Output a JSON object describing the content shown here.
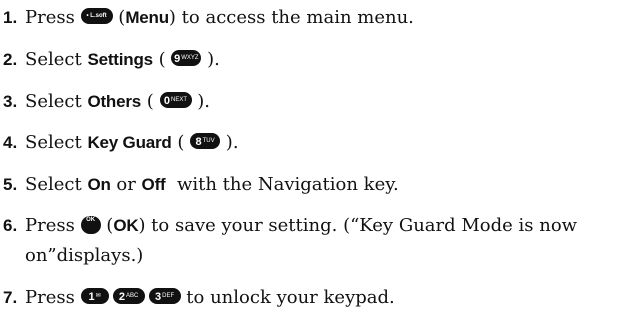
{
  "steps": [
    {
      "num": "1.",
      "pre": "Press ",
      "key": "• L.soft",
      "mid": " (",
      "bold": "Menu",
      "post": ") to access the main menu."
    },
    {
      "num": "2.",
      "pre": "Select ",
      "bold": "Settings",
      "mid": " ( ",
      "key_digit": "9",
      "key_sub": "WXYZ",
      "post": " )."
    },
    {
      "num": "3.",
      "pre": "Select ",
      "bold": "Others",
      "mid": " ( ",
      "key_digit": "0",
      "key_sub": "NEXT",
      "post": " )."
    },
    {
      "num": "4.",
      "pre": "Select ",
      "bold": "Key Guard",
      "mid": " ( ",
      "key_digit": "8",
      "key_sub": "TUV",
      "post": " )."
    },
    {
      "num": "5.",
      "pre": "Select ",
      "bold1": "On",
      "mid": " or ",
      "bold2": "Off",
      "post": "  with the Navigation key."
    },
    {
      "num": "6.",
      "pre": "Press ",
      "key": "OK",
      "mid": " (",
      "bold": "OK",
      "post": ") to save your setting. (“Key Guard Mode is now",
      "cont": "on”displays.)"
    },
    {
      "num": "7.",
      "pre": "Press ",
      "keys": [
        {
          "digit": "1",
          "sub": "✉"
        },
        {
          "digit": "2",
          "sub": "ABC"
        },
        {
          "digit": "3",
          "sub": "DEF"
        }
      ],
      "post": " to unlock your keypad."
    }
  ]
}
